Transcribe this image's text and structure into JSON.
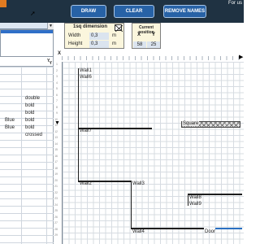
{
  "header": {
    "top_note": "For us",
    "buttons": {
      "draw": "DRAW",
      "clear": "CLEAR",
      "remove_names": "REMOVE NAMES"
    }
  },
  "left_panel": {
    "y_header": "Y",
    "line_styles": [
      "double",
      "bold",
      "bold",
      "bold",
      "bold",
      "crossed"
    ],
    "colors": [
      "Blue",
      "Blue"
    ]
  },
  "dimension_box": {
    "title": "1sq dimension",
    "width_label": "Width",
    "width_value": "0,3",
    "width_unit": "m",
    "height_label": "Height",
    "height_value": "0,3",
    "height_unit": "m"
  },
  "position_box": {
    "title": "Current position",
    "x_label": "X",
    "y_label": "Y",
    "x_value": "58",
    "y_value": "25"
  },
  "canvas": {
    "x_axis": "X",
    "y_axis": "Y",
    "row_numbers": [
      "1",
      "2",
      "3",
      "4",
      "5",
      "6",
      "7",
      "8",
      "9",
      "10",
      "11",
      "12",
      "13",
      "14",
      "15",
      "16",
      "17",
      "18",
      "19",
      "20",
      "21",
      "22",
      "23",
      "24",
      "25",
      "26",
      "27",
      "28",
      "29"
    ],
    "labels": {
      "wall1": "Wall1",
      "wall6": "Wall6",
      "wall7": "Wall7",
      "square": "Square",
      "wall2": "Wall2",
      "wall3": "Wall3",
      "wall8": "Wall8",
      "wall9": "Wall9",
      "wall4": "Wall4",
      "door": "Door"
    }
  },
  "colors": {
    "band": "#1f3242",
    "button": "#2762a6",
    "accent": "#e07b21",
    "door": "#2a6fc2"
  }
}
